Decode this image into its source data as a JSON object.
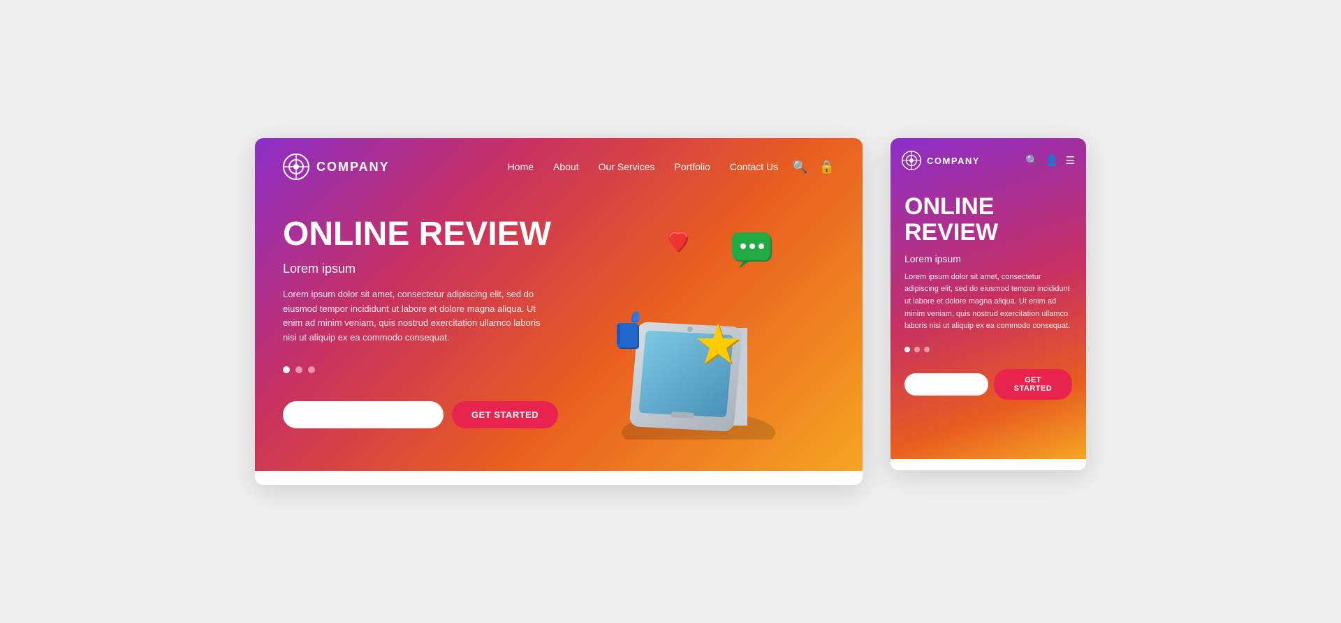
{
  "desktop": {
    "logo": {
      "text": "COMPANY",
      "icon": "logo-circle-icon"
    },
    "nav": {
      "links": [
        {
          "label": "Home",
          "key": "home"
        },
        {
          "label": "About",
          "key": "about"
        },
        {
          "label": "Our Services",
          "key": "services"
        },
        {
          "label": "Portfolio",
          "key": "portfolio"
        },
        {
          "label": "Contact Us",
          "key": "contact"
        }
      ]
    },
    "hero": {
      "title": "ONLINE REVIEW",
      "subtitle": "Lorem ipsum",
      "body": "Lorem ipsum dolor sit amet, consectetur adipiscing elit, sed do eiusmod tempor incididunt ut labore et dolore magna aliqua. Ut enim ad minim veniam, quis nostrud exercitation ullamco laboris nisi ut aliquip ex ea commodo consequat.",
      "input_placeholder": "",
      "cta_button": "GET STARTED"
    },
    "dots": [
      {
        "active": true
      },
      {
        "active": false
      },
      {
        "active": false
      }
    ]
  },
  "mobile": {
    "logo": {
      "text": "COMPANY",
      "icon": "logo-circle-icon"
    },
    "nav_icons": [
      "search",
      "user",
      "menu"
    ],
    "hero": {
      "title": "ONLINE REVIEW",
      "subtitle": "Lorem ipsum",
      "body": "Lorem ipsum dolor sit amet, consectetur adipiscing elit, sed do eiusmod tempor incididunt ut labore et dolore magna aliqua. Ut enim ad minim veniam, quis nostrud exercitation ullamco laboris nisi ut aliquip ex ea commodo consequat.",
      "input_placeholder": "",
      "cta_button": "GET STARTED"
    },
    "dots": [
      {
        "active": true
      },
      {
        "active": false
      },
      {
        "active": false
      }
    ]
  },
  "colors": {
    "gradient_start": "#8b2fc9",
    "gradient_mid": "#c83060",
    "gradient_end": "#f5a623",
    "cta_red": "#e8234e",
    "nav_icon_color": "white"
  }
}
